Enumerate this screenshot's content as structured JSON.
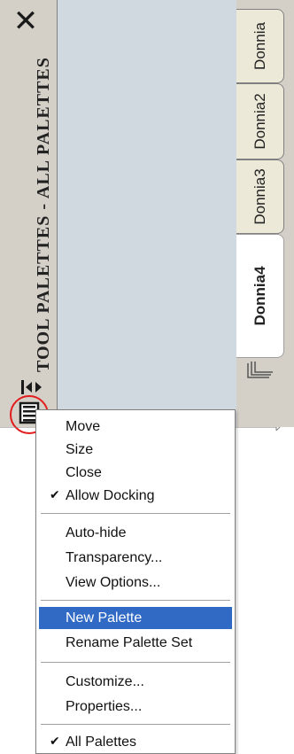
{
  "window": {
    "title": "TOOL PALETTES - ALL PALETTES",
    "close_icon": "close-icon",
    "content_bg": "#d0d8e0"
  },
  "tabs": [
    {
      "label": "Donnia",
      "active": false
    },
    {
      "label": "Donnia2",
      "active": false
    },
    {
      "label": "Donnia3",
      "active": false
    },
    {
      "label": "Donnia4",
      "active": true
    }
  ],
  "menu": {
    "highlight_color": "#316ac5",
    "groups": [
      [
        {
          "label": "Move",
          "checked": false
        },
        {
          "label": "Size",
          "checked": false
        },
        {
          "label": "Close",
          "checked": false
        },
        {
          "label": "Allow Docking",
          "checked": true
        }
      ],
      [
        {
          "label": "Auto-hide",
          "checked": false
        },
        {
          "label": "Transparency...",
          "checked": false
        },
        {
          "label": "View Options...",
          "checked": false
        }
      ],
      [
        {
          "label": "New Palette",
          "checked": false,
          "selected": true
        },
        {
          "label": "Rename Palette Set",
          "checked": false
        }
      ],
      [
        {
          "label": "Customize...",
          "checked": false
        },
        {
          "label": "Properties...",
          "checked": false
        }
      ],
      [
        {
          "label": "All Palettes",
          "checked": true
        }
      ]
    ]
  }
}
